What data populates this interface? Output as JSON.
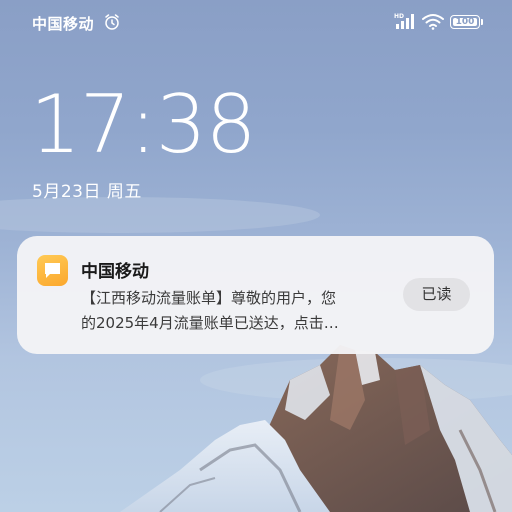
{
  "status_bar": {
    "carrier": "中国移动",
    "alarm_icon": "alarm-clock-icon",
    "network_badge": "HD",
    "signal_icon": "cellular-signal-icon",
    "wifi_icon": "wifi-icon",
    "battery_level": "100"
  },
  "lockscreen": {
    "time": "17:38",
    "date": "5月23日 周五"
  },
  "notification": {
    "app_icon": "message-bubble-icon",
    "app_name": "中国移动",
    "message_line1": "【江西移动流量账单】尊敬的用户，您",
    "message_line2": "的2025年4月流量账单已送达，点击…",
    "mark_read_label": "已读",
    "icon_color": "#fbb33a"
  }
}
